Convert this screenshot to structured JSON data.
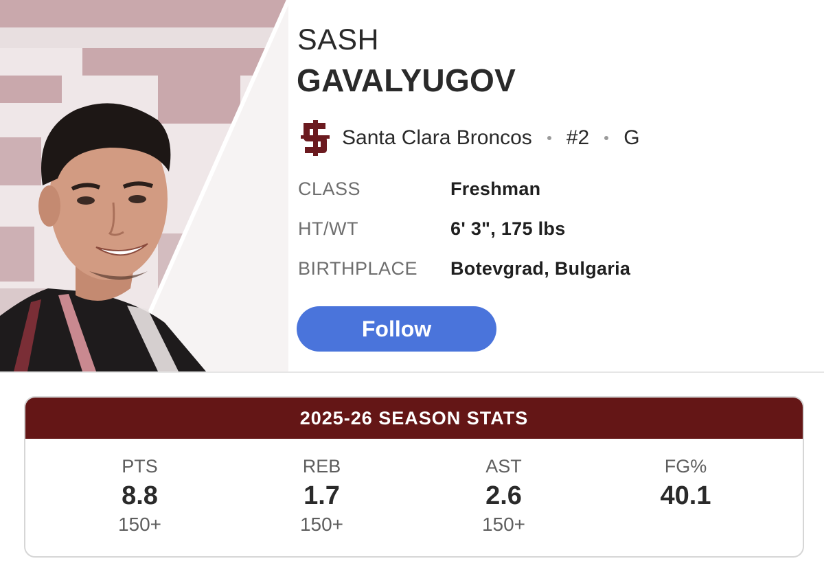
{
  "player": {
    "first_name": "SASH",
    "last_name": "GAVALYUGOV",
    "team": "Santa Clara Broncos",
    "number": "#2",
    "position": "G",
    "team_logo_icon": "santa-clara-sc-logo-icon",
    "team_color": "#6b1a1f"
  },
  "info": [
    {
      "label": "CLASS",
      "value": "Freshman"
    },
    {
      "label": "HT/WT",
      "value": "6' 3\", 175 lbs"
    },
    {
      "label": "BIRTHPLACE",
      "value": "Botevgrad, Bulgaria"
    }
  ],
  "follow": {
    "label": "Follow",
    "color": "#4a74db"
  },
  "season_stats": {
    "title": "2025-26 SEASON STATS",
    "header_color": "#641616",
    "stats": [
      {
        "label": "PTS",
        "value": "8.8",
        "rank": "150+"
      },
      {
        "label": "REB",
        "value": "1.7",
        "rank": "150+"
      },
      {
        "label": "AST",
        "value": "2.6",
        "rank": "150+"
      },
      {
        "label": "FG%",
        "value": "40.1",
        "rank": ""
      }
    ]
  }
}
